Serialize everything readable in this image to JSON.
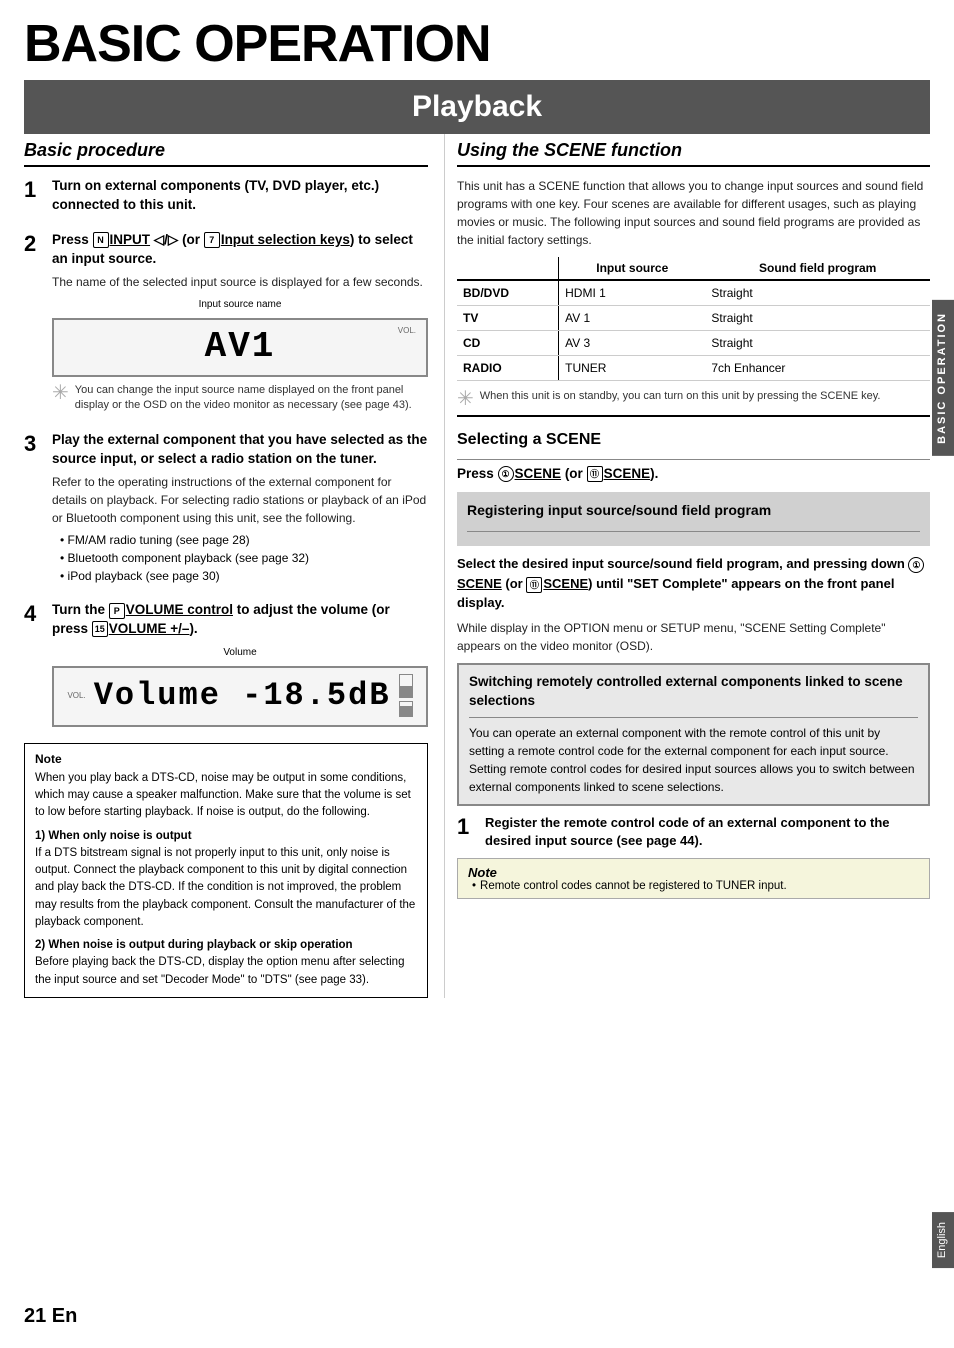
{
  "page": {
    "main_title": "BASIC OPERATION",
    "playback_title": "Playback",
    "page_number": "21 En",
    "sidebar_label": "BASIC OPERATION",
    "english_label": "English"
  },
  "left": {
    "section_heading": "Basic procedure",
    "step1": {
      "number": "1",
      "title": "Turn on external components (TV, DVD player, etc.) connected to this unit."
    },
    "step2": {
      "number": "2",
      "title_before": "Press ",
      "title_key": "INPUT",
      "title_middle": " ◁/▷ (or ",
      "title_key2": "Input selection keys",
      "title_after": ") to select an input source.",
      "body": "The name of the selected input source is displayed for a few seconds.",
      "display_label": "Input source name",
      "display_text": "AV1",
      "vol_label": "VOL.",
      "tip_text": "You can change the input source name displayed on the front panel display or the OSD on the video monitor as necessary (see page 43)."
    },
    "step3": {
      "number": "3",
      "title": "Play the external component that you have selected as the source input, or select a radio station on the tuner.",
      "body": "Refer to the operating instructions of the external component for details on playback. For selecting radio stations or playback of an iPod or Bluetooth component using this unit, see the following.",
      "bullets": [
        "FM/AM radio tuning (see page 28)",
        "Bluetooth component playback (see page 32)",
        "iPod playback (see page 30)"
      ]
    },
    "step4": {
      "number": "4",
      "title_before": "Turn the ",
      "title_key": "VOLUME control",
      "title_middle": " to adjust the volume (or press ",
      "title_key2": "VOLUME +/–",
      "title_after": ").",
      "display_label": "Volume",
      "display_text": "Volume -18.5dB",
      "vol_label": "VOL."
    },
    "note": {
      "title": "Note",
      "body1": "When you play back a DTS-CD, noise may be output in some conditions, which may cause a speaker malfunction. Make sure that the volume is set to low before starting playback. If noise is output, do the following.",
      "section1_title": "1) When only noise is output",
      "section1_body": "If a DTS bitstream signal is not properly input to this unit, only noise is output. Connect the playback component to this unit by digital connection and play back the DTS-CD. If the condition is not improved, the problem may results from the playback component. Consult the manufacturer of the playback component.",
      "section2_title": "2) When noise is output during playback or skip operation",
      "section2_body": "Before playing back the DTS-CD, display the option menu after selecting the input source and set \"Decoder Mode\" to \"DTS\" (see page 33)."
    }
  },
  "right": {
    "section_heading": "Using the SCENE function",
    "intro": "This unit has a SCENE function that allows you to change input sources and sound field programs with one key. Four scenes are available for different usages, such as playing movies or music. The following input sources and sound field programs are provided as the initial factory settings.",
    "table": {
      "headers": [
        "",
        "Input source",
        "Sound field program"
      ],
      "rows": [
        [
          "BD/DVD",
          "HDMI 1",
          "Straight"
        ],
        [
          "TV",
          "AV 1",
          "Straight"
        ],
        [
          "CD",
          "AV 3",
          "Straight"
        ],
        [
          "RADIO",
          "TUNER",
          "7ch Enhancer"
        ]
      ]
    },
    "tip_text": "When this unit is on standby, you can turn on this unit by pressing the SCENE key.",
    "selecting_heading": "Selecting a SCENE",
    "press_instruction": "Press ①SCENE (or ⑪SCENE).",
    "registering_heading": "Registering input source/sound field program",
    "register_body": "Select the desired input source/sound field program, and pressing down ①SCENE (or ⑪SCENE) until \"SET Complete\" appears on the front panel display.",
    "register_note": "While display in the OPTION menu or SETUP menu, \"SCENE Setting Complete\" appears on the video monitor (OSD).",
    "switching": {
      "title": "Switching remotely controlled external components linked to scene selections",
      "body": "You can operate an external component with the remote control of this unit by setting a remote control code for the external component for each input source. Setting remote control codes for desired input sources allows you to switch between external components linked to scene selections."
    },
    "right_step1": {
      "number": "1",
      "title": "Register the remote control code of an external component to the desired input source (see page 44)."
    },
    "note_italic": {
      "title": "Note",
      "bullet": "Remote control codes cannot be registered to TUNER input."
    }
  }
}
